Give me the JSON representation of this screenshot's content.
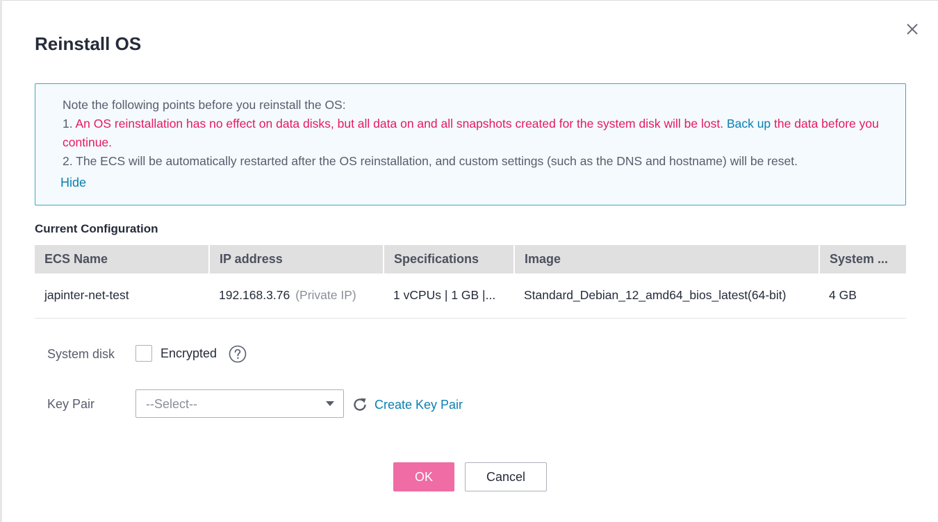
{
  "dialog": {
    "title": "Reinstall OS",
    "close_icon": "close-icon"
  },
  "notice": {
    "intro": "Note the following points before you reinstall the OS:",
    "point1_prefix": "1. ",
    "point1_warning": "An OS reinstallation has no effect on data disks, but all data on and all snapshots created for the system disk will be lost.",
    "point1_link": "Back up",
    "point1_suffix": "the data before you continue.",
    "point2": "2. The ECS will be automatically restarted after the OS reinstallation, and custom settings (such as the DNS and hostname) will be reset.",
    "hide_label": "Hide"
  },
  "config": {
    "section_title": "Current Configuration",
    "columns": [
      "ECS Name",
      "IP address",
      "Specifications",
      "Image",
      "System ..."
    ],
    "row": {
      "ecs_name": "japinter-net-test",
      "ip": "192.168.3.76",
      "ip_type": "(Private IP)",
      "specs": "1 vCPUs | 1 GB |...",
      "image": "Standard_Debian_12_amd64_bios_latest(64-bit)",
      "system_disk": "4 GB"
    }
  },
  "form": {
    "system_disk_label": "System disk",
    "encrypted_label": "Encrypted",
    "encrypted_checked": false,
    "help_icon": "question-circle-icon",
    "key_pair_label": "Key Pair",
    "key_pair_value": "--Select--",
    "refresh_icon": "refresh-icon",
    "create_key_pair_label": "Create Key Pair"
  },
  "footer": {
    "ok_label": "OK",
    "cancel_label": "Cancel"
  },
  "colors": {
    "primary": "#ef6ca4",
    "warning": "#e6195f",
    "link": "#0a7fb0",
    "notice_border": "#3ea6c8",
    "notice_bg": "#f4fafd"
  }
}
